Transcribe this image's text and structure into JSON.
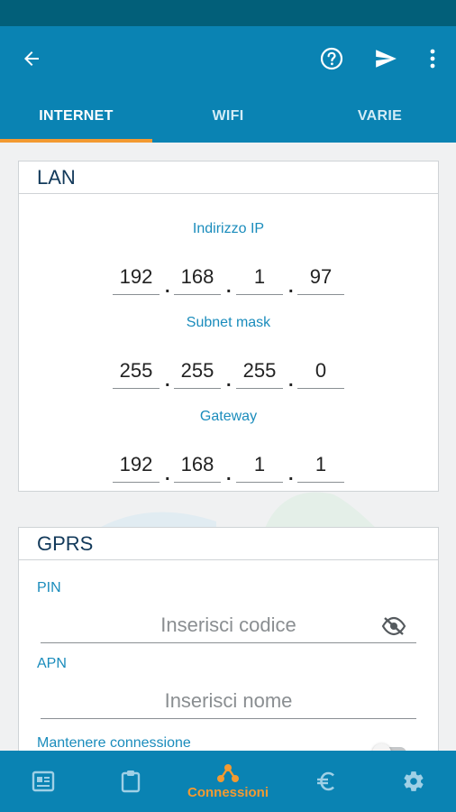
{
  "colors": {
    "status_bar": "#025f79",
    "primary": "#0a83b3",
    "accent": "#f39a31",
    "card_title": "#12395a",
    "label": "#1a8cbc"
  },
  "header": {
    "back_icon": "arrow-left-icon",
    "help_icon": "question-circle-icon",
    "send_icon": "send-icon",
    "menu_icon": "more-vert-icon"
  },
  "tabs": [
    {
      "label": "INTERNET",
      "active": true
    },
    {
      "label": "WIFI",
      "active": false
    },
    {
      "label": "VARIE",
      "active": false
    }
  ],
  "lan": {
    "title": "LAN",
    "ip_label": "Indirizzo IP",
    "ip": [
      "192",
      "168",
      "1",
      "97"
    ],
    "subnet_label": "Subnet mask",
    "subnet": [
      "255",
      "255",
      "255",
      "0"
    ],
    "gateway_label": "Gateway",
    "gateway": [
      "192",
      "168",
      "1",
      "1"
    ]
  },
  "gprs": {
    "title": "GPRS",
    "pin_label": "PIN",
    "pin_placeholder": "Inserisci codice",
    "pin_visibility_icon": "eye-off-icon",
    "apn_label": "APN",
    "apn_placeholder": "Inserisci nome",
    "keep_connection_label": "Mantenere connessione",
    "keep_connection_on": false
  },
  "bottom_nav": [
    {
      "icon": "news-icon",
      "label": ""
    },
    {
      "icon": "clipboard-icon",
      "label": ""
    },
    {
      "icon": "network-icon",
      "label": "Connessioni",
      "active": true
    },
    {
      "icon": "euro-icon",
      "label": ""
    },
    {
      "icon": "gear-icon",
      "label": ""
    }
  ]
}
